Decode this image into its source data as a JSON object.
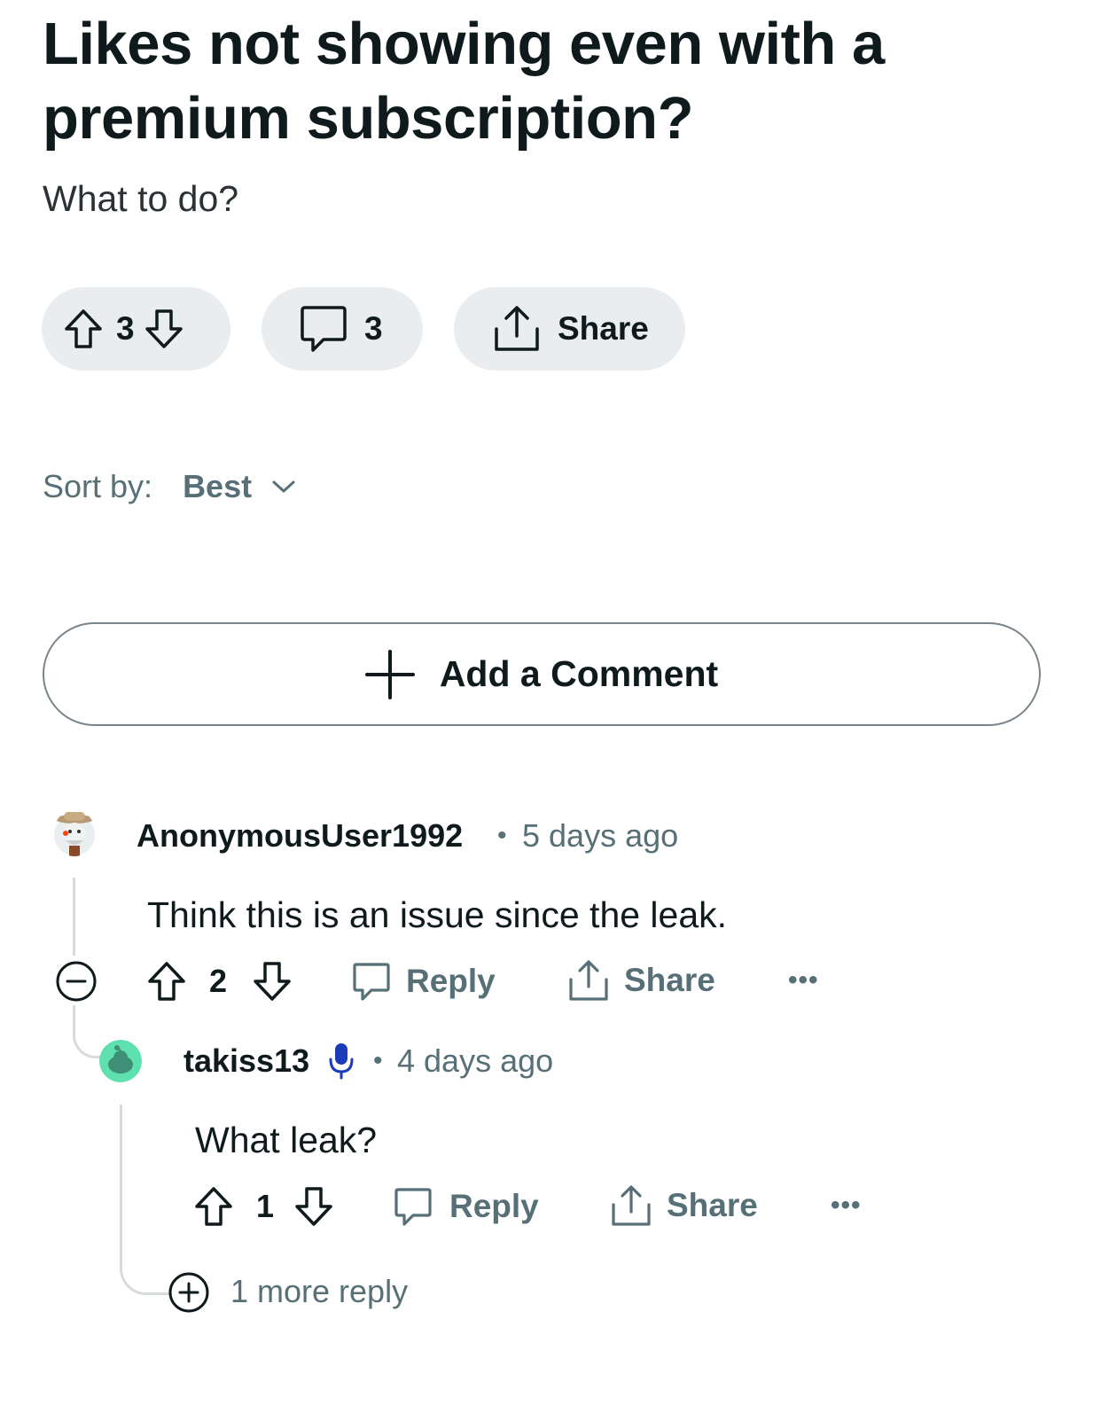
{
  "post": {
    "title": "Likes not showing even with a premium subscription?",
    "body": "What to do?",
    "score": "3",
    "comment_count": "3",
    "share_label": "Share"
  },
  "sort": {
    "label": "Sort by:",
    "value": "Best"
  },
  "add_comment": {
    "label": "Add a Comment"
  },
  "comments": [
    {
      "username": "AnonymousUser1992",
      "timestamp": "5 days ago",
      "text": "Think this is an issue since the leak.",
      "score": "2",
      "reply_label": "Reply",
      "share_label": "Share",
      "more": "•••",
      "avatar_color": "#d9e2e4"
    },
    {
      "username": "takiss13",
      "timestamp": "4 days ago",
      "text": "What leak?",
      "score": "1",
      "reply_label": "Reply",
      "share_label": "Share",
      "more": "•••",
      "avatar_color": "#5fe0b0",
      "badge_icon": "microphone-icon",
      "badge_color": "#1c3bb8"
    }
  ],
  "more_replies": {
    "label": "1 more reply"
  },
  "separator": "•"
}
